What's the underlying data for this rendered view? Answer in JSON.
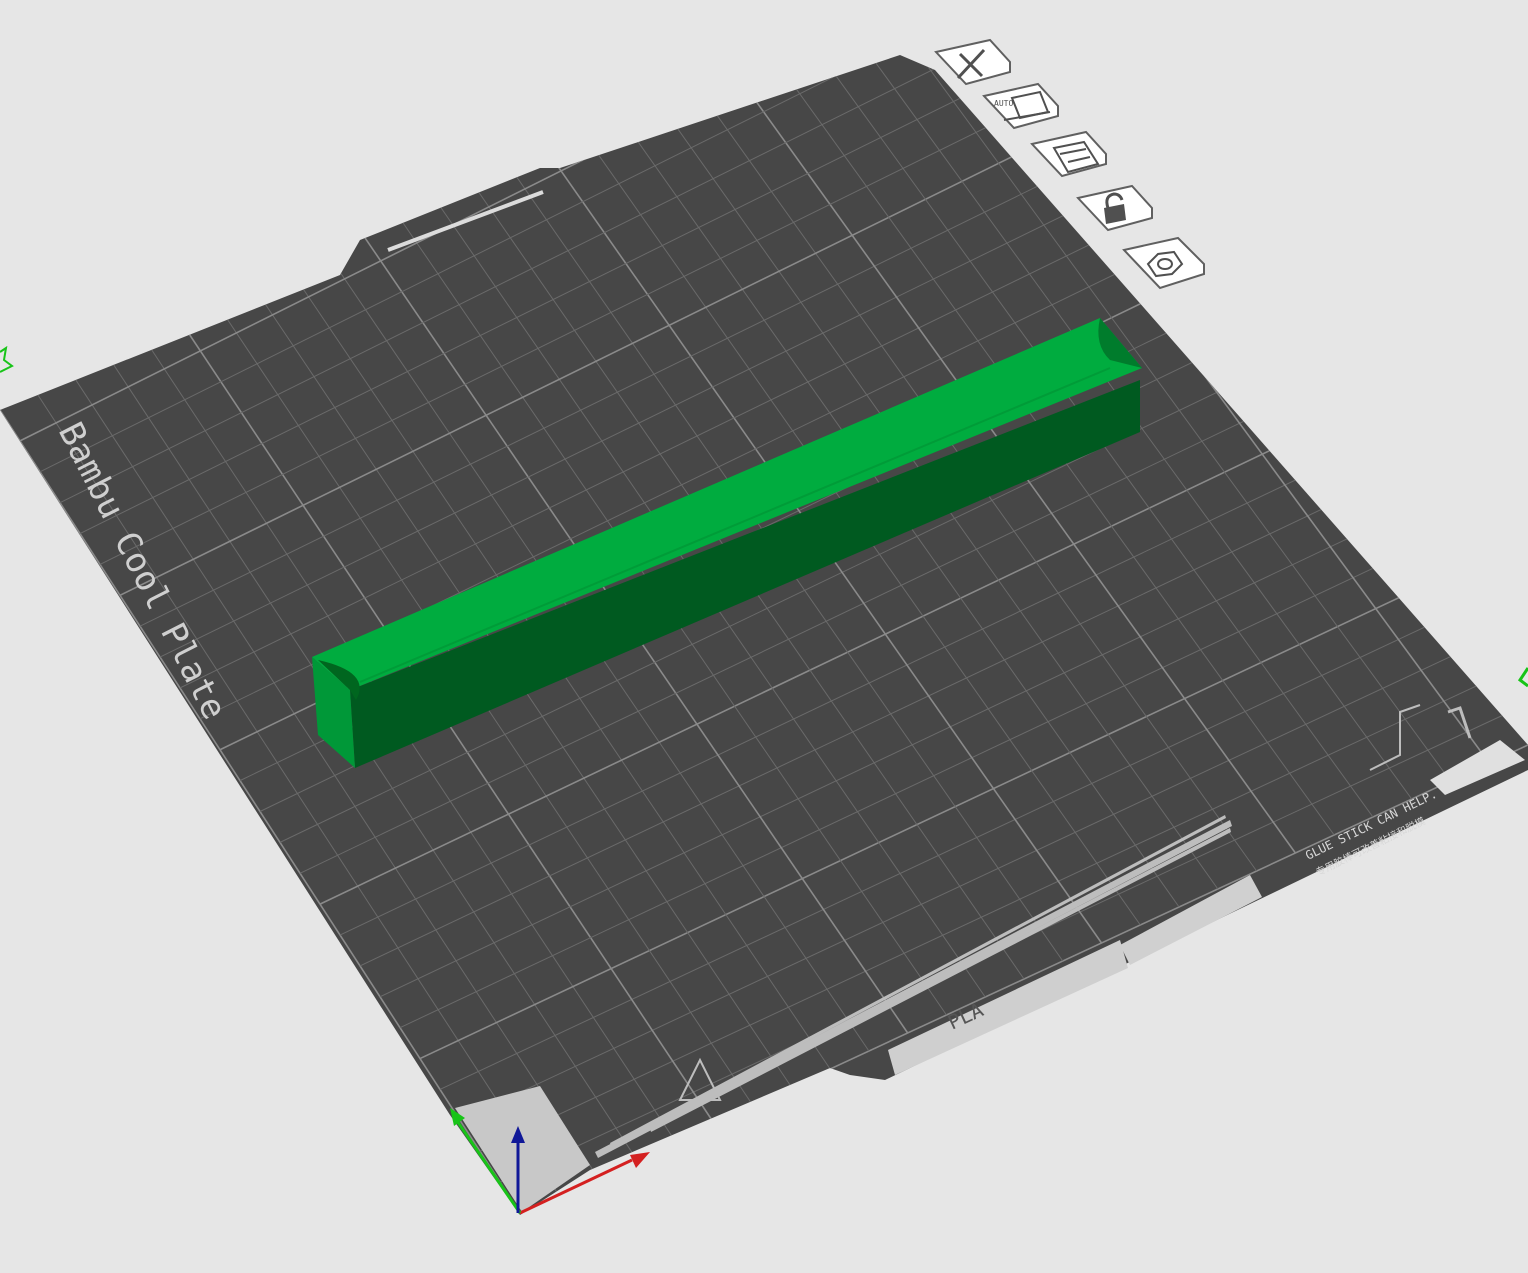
{
  "plate": {
    "name": "Bambu Cool Plate",
    "filament_label": "PLA",
    "hint_en": "GLUE STICK CAN HELP.",
    "hint_cn": "专用胶棒可改善粘接和脱模"
  },
  "toolbar": {
    "buttons": [
      {
        "name": "close-plate-button",
        "icon": "close-icon"
      },
      {
        "name": "auto-orient-button",
        "icon": "auto-orient-icon",
        "badge": "AUTO"
      },
      {
        "name": "arrange-button",
        "icon": "arrange-icon"
      },
      {
        "name": "lock-plate-button",
        "icon": "unlock-icon"
      },
      {
        "name": "plate-settings-button",
        "icon": "settings-icon"
      }
    ]
  },
  "model": {
    "name": "half-pipe-bar",
    "color": "#00ac3f"
  },
  "axes": {
    "x_color": "#d42020",
    "y_color": "#18c418",
    "z_color": "#101898"
  }
}
